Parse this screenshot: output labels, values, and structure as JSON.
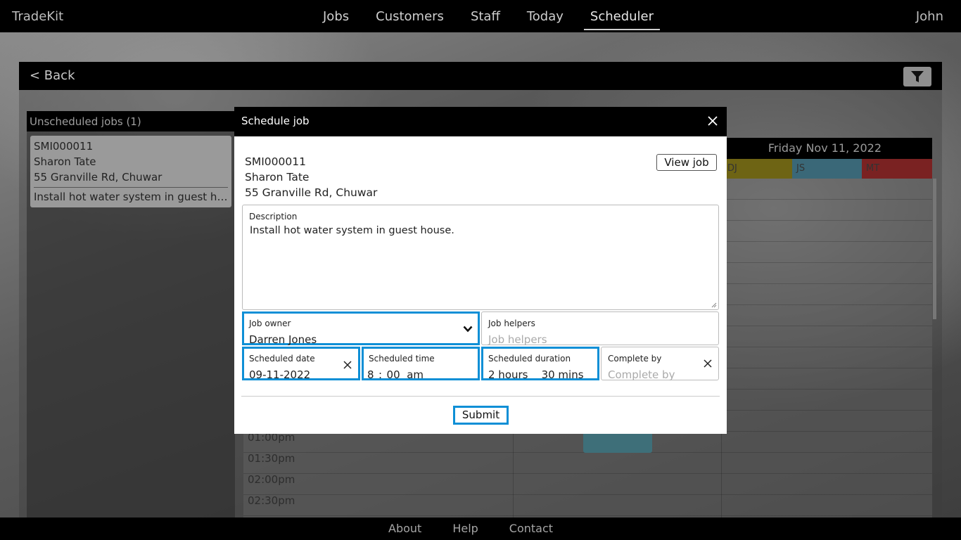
{
  "app": {
    "brand": "TradeKit",
    "user": "John"
  },
  "nav": {
    "items": [
      {
        "label": "Jobs"
      },
      {
        "label": "Customers"
      },
      {
        "label": "Staff"
      },
      {
        "label": "Today"
      },
      {
        "label": "Scheduler"
      }
    ],
    "active": "Scheduler"
  },
  "toolbar": {
    "back_label": "< Back",
    "filter_icon": "filter-icon"
  },
  "unscheduled": {
    "header": "Unscheduled jobs (1)",
    "jobs": [
      {
        "id": "SMI000011",
        "customer": "Sharon Tate",
        "address": "55 Granville Rd, Chuwar",
        "description": "Install hot water system in guest house."
      }
    ]
  },
  "calendar": {
    "date_header": "Friday Nov 11, 2022",
    "staff_columns": [
      {
        "initials": "DJ",
        "color": "#b5a51e"
      },
      {
        "initials": "JS",
        "color": "#3c9cb8"
      },
      {
        "initials": "MT",
        "color": "#b52c2c"
      }
    ],
    "times": [
      "01:00pm",
      "01:30pm",
      "02:00pm",
      "02:30pm"
    ]
  },
  "modal": {
    "title": "Schedule job",
    "job_id": "SMI000011",
    "customer": "Sharon Tate",
    "address": "55 Granville Rd, Chuwar",
    "view_job_label": "View job",
    "description": {
      "label": "Description",
      "value": "Install hot water system in guest house."
    },
    "job_owner": {
      "label": "Job owner",
      "value": "Darren Jones"
    },
    "job_helpers": {
      "label": "Job helpers",
      "placeholder": "Job helpers"
    },
    "scheduled_date": {
      "label": "Scheduled date",
      "value": "09-11-2022"
    },
    "scheduled_time": {
      "label": "Scheduled time",
      "hour": "8",
      "sep": ":",
      "minute": "00",
      "ampm": "am"
    },
    "scheduled_duration": {
      "label": "Scheduled duration",
      "hours": "2 hours",
      "mins": "30 mins"
    },
    "complete_by": {
      "label": "Complete by",
      "placeholder": "Complete by"
    },
    "submit_label": "Submit",
    "accent": "#0e8fd6"
  },
  "footer": {
    "links": [
      "About",
      "Help",
      "Contact"
    ]
  }
}
